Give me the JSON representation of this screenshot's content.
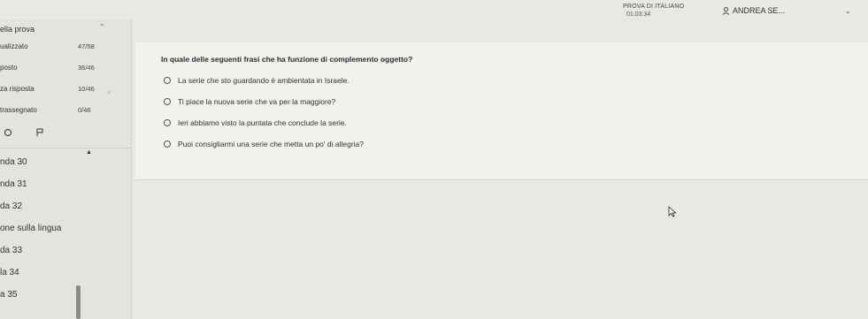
{
  "header": {
    "exam_title": "PROVA DI ITALIANO",
    "timer": "01:03:34",
    "user_name": "ANDREA SE..."
  },
  "sidebar": {
    "section_title": "ella prova",
    "stats": [
      {
        "label": "ualizzato",
        "value": "47/58"
      },
      {
        "label": "posto",
        "value": "36/46"
      },
      {
        "label": "za risposta",
        "value": "10/46"
      },
      {
        "label": "trassegnato",
        "value": "0/46"
      }
    ],
    "items": [
      {
        "label": "nda 30"
      },
      {
        "label": "nda 31"
      },
      {
        "label": "da 32"
      },
      {
        "label": "one sulla lingua"
      },
      {
        "label": "da 33"
      },
      {
        "label": "la 34"
      },
      {
        "label": "a 35"
      }
    ]
  },
  "question": {
    "text": "In quale delle seguenti frasi che ha funzione di complemento oggetto?",
    "options": [
      {
        "text": "La serie che sto guardando è ambientata in Israele."
      },
      {
        "text": "Ti piace la nuova serie che va per la maggiore?"
      },
      {
        "text": "Ieri abbiamo visto la puntata che conclude la serie."
      },
      {
        "text": "Puoi consigliarmi una serie che metta un po' di allegria?"
      }
    ]
  }
}
